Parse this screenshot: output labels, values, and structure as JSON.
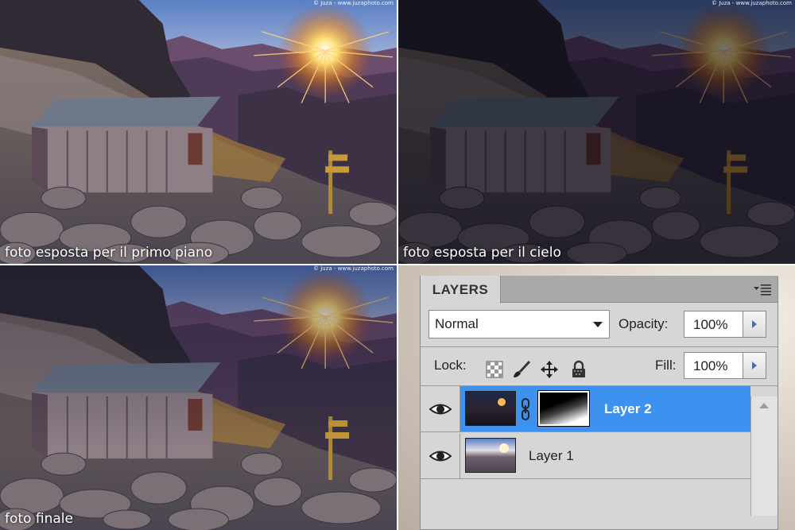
{
  "photos": [
    {
      "id": "primo-piano",
      "caption": "foto esposta per il primo piano",
      "credit": "© Juza - www.juzaphoto.com"
    },
    {
      "id": "cielo",
      "caption": "foto esposta per il cielo",
      "credit": "© Juza - www.juzaphoto.com"
    },
    {
      "id": "finale",
      "caption": "foto finale",
      "credit": "© Juza - www.juzaphoto.com"
    }
  ],
  "layers_panel": {
    "tab_label": "LAYERS",
    "menu_icon": "panel-menu-icon",
    "blend_mode": "Normal",
    "opacity_label": "Opacity:",
    "opacity_value": "100%",
    "lock_label": "Lock:",
    "lock_icons": [
      "lock-transparent-pixels-icon",
      "lock-image-pixels-icon",
      "lock-position-icon",
      "lock-all-icon"
    ],
    "fill_label": "Fill:",
    "fill_value": "100%",
    "layers": [
      {
        "name": "Layer 2",
        "selected": true,
        "has_mask": true
      },
      {
        "name": "Layer 1",
        "selected": false,
        "has_mask": false
      }
    ],
    "colors": {
      "selected_row": "#3d92f0",
      "panel_bg": "#d6d6d6",
      "tabbar_bg": "#a9a9a9"
    }
  }
}
